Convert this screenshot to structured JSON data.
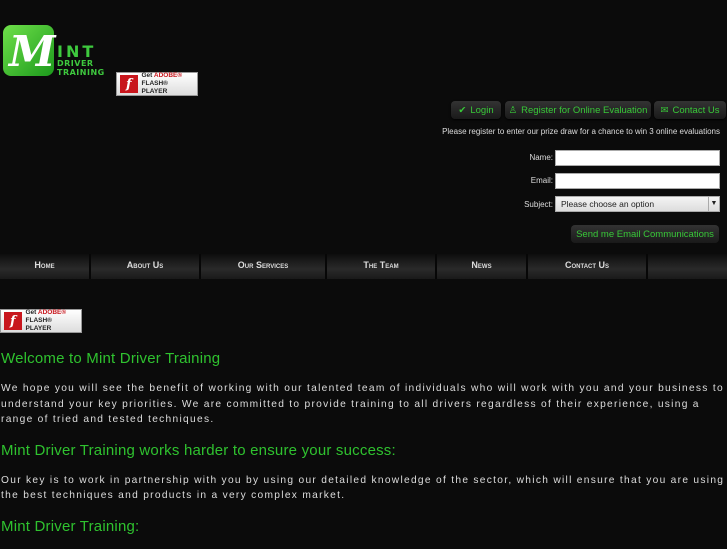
{
  "logo": {
    "mark": "M",
    "word": "INT",
    "line1": "DRIVER",
    "line2": "TRAINING"
  },
  "flash": {
    "get": "Get ",
    "adobe": "ADOBE®",
    "player": "FLASH® PLAYER"
  },
  "topbar": {
    "login": "Login",
    "register": "Register for Online Evaluation",
    "contact": "Contact Us"
  },
  "form": {
    "note": "Please register to enter our prize draw for a chance to win 3 online evaluations",
    "name_label": "Name:",
    "email_label": "Email:",
    "subject_label": "Subject:",
    "name_value": "",
    "email_value": "",
    "subject_selected": "Please choose an option",
    "submit": "Send me Email Communications"
  },
  "nav": [
    "Home",
    "About Us",
    "Our Services",
    "The Team",
    "News",
    "Contact Us",
    ""
  ],
  "content": {
    "h1": "Welcome to Mint Driver Training",
    "p1": "We hope you will see the benefit of working with our talented team of individuals who will work with you and your business to understand your key priorities. We are committed to provide training to all drivers regardless of their experience, using a range of tried and tested techniques.",
    "h2": "Mint Driver Training works harder to ensure your success:",
    "p2": "Our key is to work in partnership with you by using our detailed knowledge of the sector, which will ensure that you are using the best techniques and products in a very complex market.",
    "h3": "Mint Driver Training:"
  },
  "colors": {
    "accent": "#2fc22f",
    "background": "#0b0b0b"
  }
}
